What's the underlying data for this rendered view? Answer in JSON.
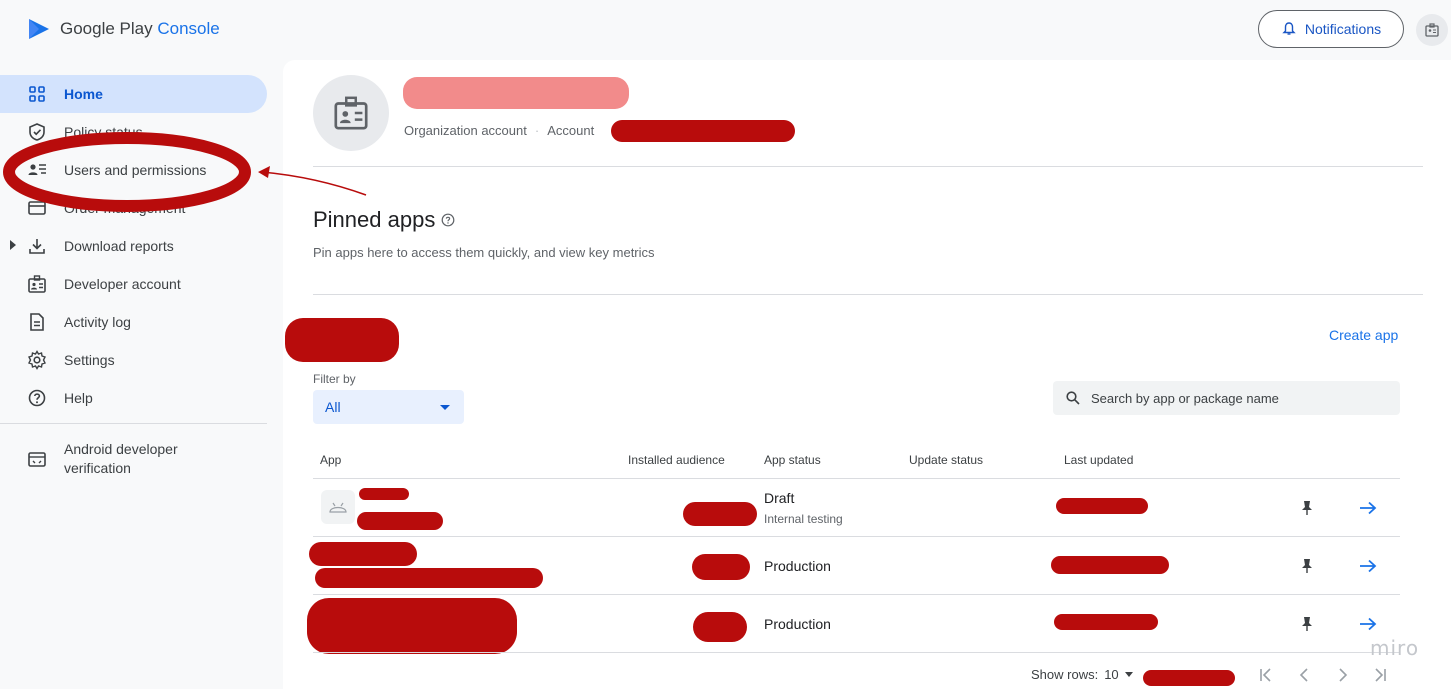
{
  "header": {
    "logo_main": "Google Play",
    "logo_accent": " Console",
    "notifications_label": "Notifications"
  },
  "sidebar": {
    "items": [
      {
        "label": "Home",
        "icon": "grid-icon",
        "active": true
      },
      {
        "label": "Policy status",
        "icon": "shield-check-icon"
      },
      {
        "label": "Users and permissions",
        "icon": "users-list-icon"
      },
      {
        "label": "Order management",
        "icon": "card-icon"
      },
      {
        "label": "Download reports",
        "icon": "download-icon"
      },
      {
        "label": "Developer account",
        "icon": "badge-icon"
      },
      {
        "label": "Activity log",
        "icon": "document-icon"
      },
      {
        "label": "Settings",
        "icon": "gear-icon"
      },
      {
        "label": "Help",
        "icon": "help-icon"
      },
      {
        "label": "Android developer verification",
        "icon": "verification-icon"
      }
    ]
  },
  "account": {
    "type_label": "Organization account",
    "separator": "·",
    "account_label": "Account"
  },
  "pinned": {
    "title": "Pinned apps",
    "subtitle": "Pin apps here to access them quickly, and view key metrics"
  },
  "apps_section": {
    "create_app": "Create app",
    "filter_label": "Filter by",
    "filter_value": "All",
    "search_placeholder": "Search by app or package name"
  },
  "table": {
    "columns": [
      "App",
      "Installed audience",
      "App status",
      "Update status",
      "Last updated"
    ],
    "rows": [
      {
        "status": "Draft",
        "substatus": "Internal testing"
      },
      {
        "status": "Production",
        "substatus": ""
      },
      {
        "status": "Production",
        "substatus": ""
      }
    ]
  },
  "pagination": {
    "show_rows_label": "Show rows:",
    "rows_value": "10"
  },
  "watermark": "miro",
  "colors": {
    "accent": "#1a73e8",
    "active_nav_bg": "#d3e3fd",
    "annotation_red": "#b80c0c"
  }
}
